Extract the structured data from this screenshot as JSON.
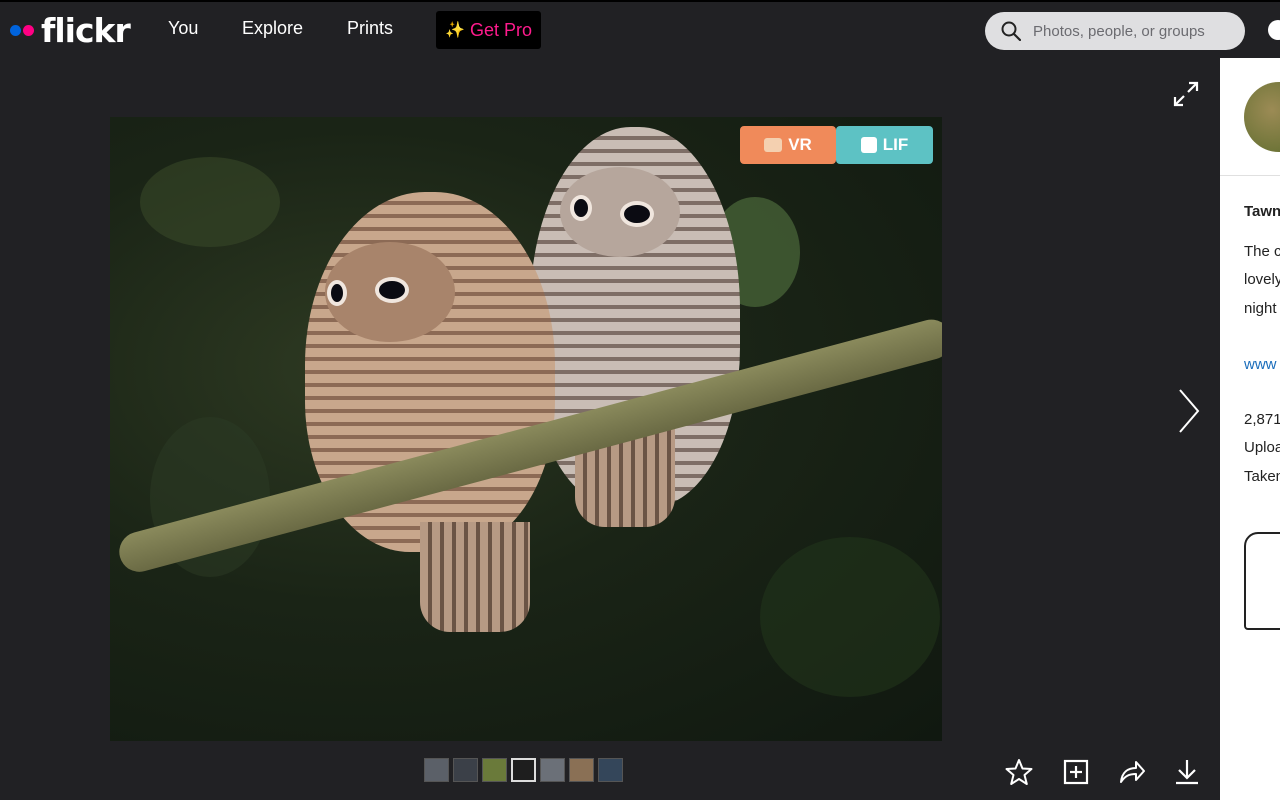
{
  "header": {
    "logo_text": "flickr",
    "nav": [
      "You",
      "Explore",
      "Prints"
    ],
    "get_pro_label": "Get Pro",
    "search_placeholder": "Photos, people, or groups"
  },
  "photo": {
    "badges": {
      "vr": "VR",
      "lif": "LIF"
    }
  },
  "sidebar": {
    "title_partial": "Tawn",
    "description_partial": [
      "The c",
      "lovely",
      "night"
    ],
    "link_partial": "www",
    "stats_partial": [
      "2,871",
      "Uploa",
      "Taken"
    ]
  },
  "thumbnails": {
    "count": 7,
    "active_index": 3,
    "colors": [
      "#5b6068",
      "#3b4048",
      "#6a7a3a",
      "#1e1e1e",
      "#6b7078",
      "#8a7055",
      "#34465a"
    ]
  },
  "actions": [
    "favorite-icon",
    "add-to-gallery-icon",
    "share-icon",
    "download-icon"
  ]
}
